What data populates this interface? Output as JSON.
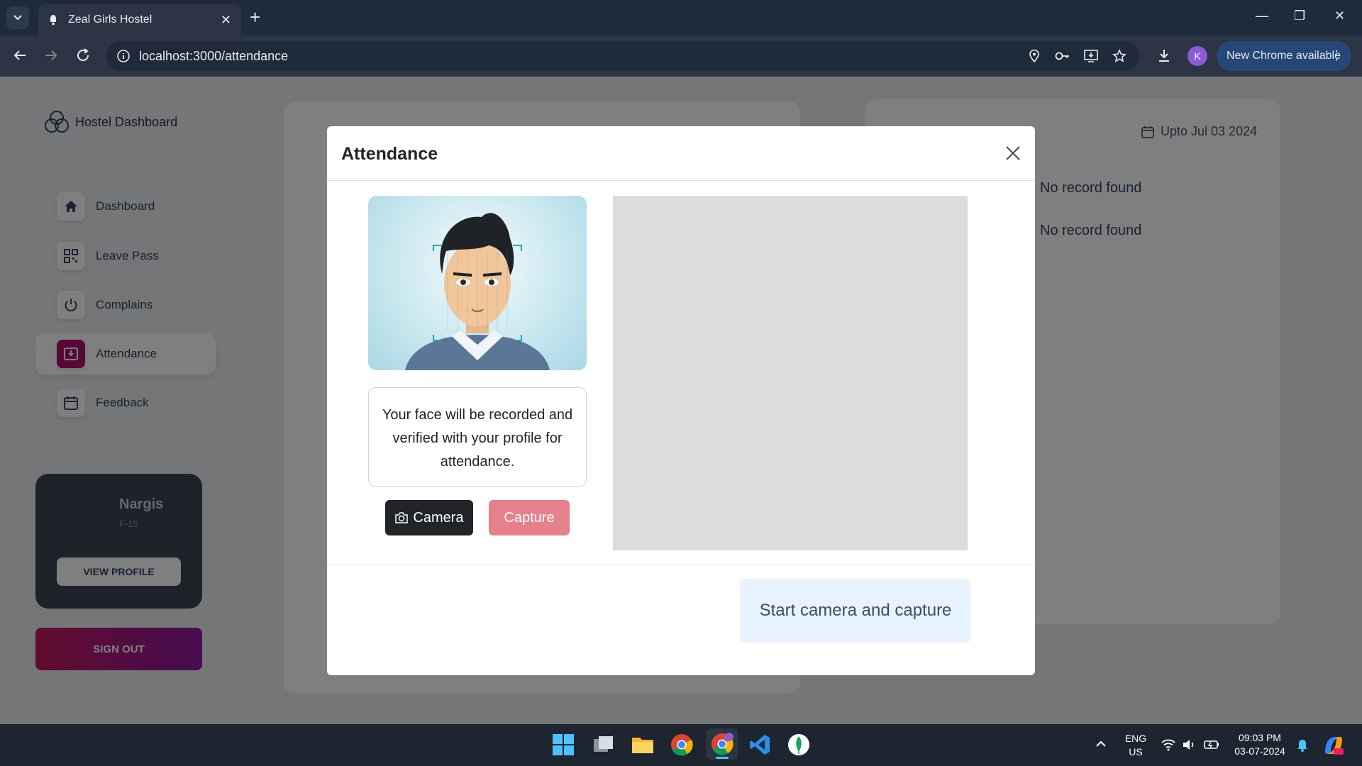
{
  "browser": {
    "tab_title": "Zeal Girls Hostel",
    "tab_close": "✕",
    "new_tab": "+",
    "url": "localhost:3000/attendance",
    "profile_initial": "K",
    "update_label": "New Chrome available",
    "update_menu": "⋮",
    "window_controls": [
      "—",
      "❐",
      "✕"
    ]
  },
  "sidebar": {
    "brand": "Hostel Dashboard",
    "items": [
      {
        "label": "Dashboard",
        "icon": "home-icon"
      },
      {
        "label": "Leave Pass",
        "icon": "qr-code-icon"
      },
      {
        "label": "Complains",
        "icon": "power-icon"
      },
      {
        "label": "Attendance",
        "icon": "download-box-icon",
        "active": true
      },
      {
        "label": "Feedback",
        "icon": "calendar-icon"
      }
    ],
    "profile": {
      "name": "Nargis",
      "room": "F-15",
      "button": "VIEW PROFILE"
    },
    "signout": "SIGN OUT"
  },
  "main": {
    "date_label": "Upto Jul 03 2024",
    "records": [
      "No record found",
      "No record found"
    ]
  },
  "modal": {
    "title": "Attendance",
    "note": "Your face will be recorded and verified with your profile for attendance.",
    "camera_button": "Camera",
    "capture_button": "Capture",
    "start_button": "Start camera and capture"
  },
  "taskbar": {
    "lang_top": "ENG",
    "lang_bottom": "US",
    "time": "09:03 PM",
    "date": "03-07-2024",
    "apps": [
      "windows-start-icon",
      "task-view-icon",
      "file-explorer-icon",
      "chrome-icon",
      "chrome-profile-icon",
      "vscode-icon",
      "mongodb-icon"
    ]
  },
  "colors": {
    "accent": "#b0106e",
    "camera_button": "#212529",
    "capture_button": "#e6818b",
    "start_button_bg": "#e8f3ff"
  }
}
